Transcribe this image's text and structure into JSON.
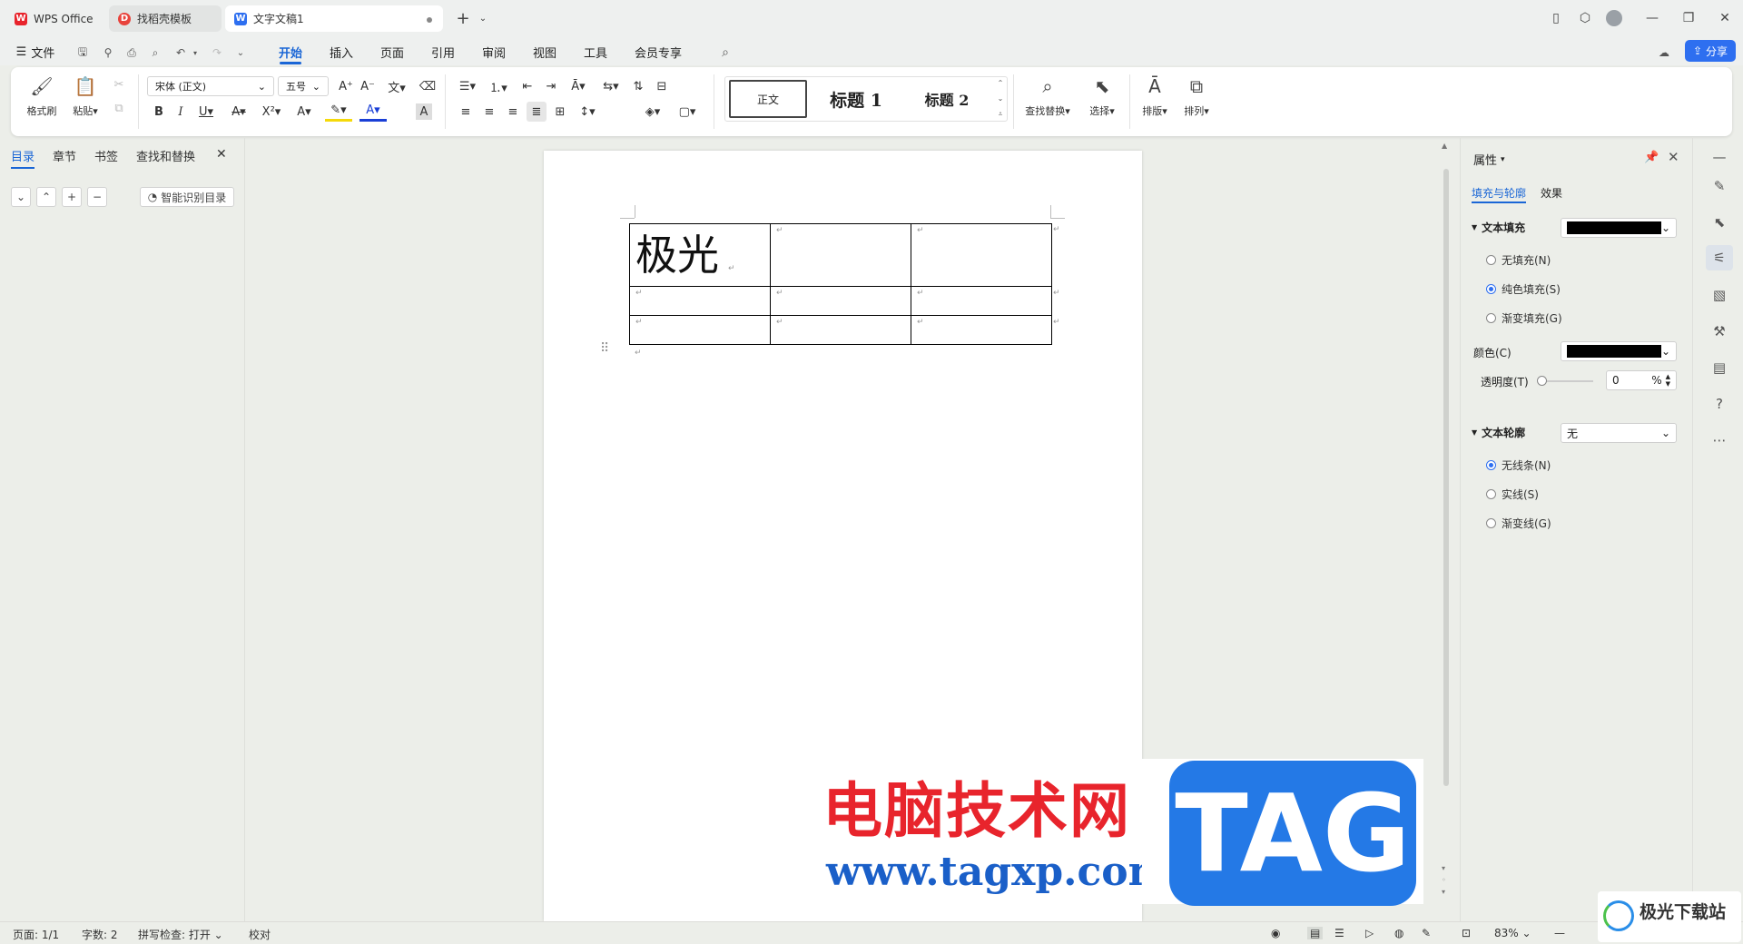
{
  "tabs": [
    {
      "label": "WPS Office",
      "icon": "wps-logo-icon"
    },
    {
      "label": "找稻壳模板",
      "icon": "docer-icon"
    },
    {
      "label": "文字文稿1",
      "icon": "writer-icon"
    }
  ],
  "menu": {
    "file": "文件",
    "items": [
      "开始",
      "插入",
      "页面",
      "引用",
      "审阅",
      "视图",
      "工具",
      "会员专享"
    ],
    "active": "开始",
    "share": "分享"
  },
  "ribbon": {
    "format_painter": "格式刷",
    "paste": "粘贴",
    "font_name": "宋体 (正文)",
    "font_size": "五号",
    "styles": [
      "正文",
      "标题 1",
      "标题 2"
    ],
    "find_replace": "查找替换",
    "select": "选择",
    "layout": "排版",
    "arrange": "排列"
  },
  "left_panel": {
    "tabs": [
      "目录",
      "章节",
      "书签",
      "查找和替换"
    ],
    "smart_toc": "智能识别目录"
  },
  "document": {
    "cell_text": "极光"
  },
  "right_panel": {
    "title": "属性",
    "tabs": [
      "填充与轮廓",
      "效果"
    ],
    "text_fill": {
      "label": "文本填充",
      "options": [
        "无填充(N)",
        "纯色填充(S)",
        "渐变填充(G)"
      ],
      "selected": 1,
      "color_label": "颜色(C)",
      "transparency_label": "透明度(T)",
      "transparency_value": "0",
      "transparency_unit": "%",
      "fill_color": "#000000"
    },
    "text_outline": {
      "label": "文本轮廓",
      "value": "无",
      "options": [
        "无线条(N)",
        "实线(S)",
        "渐变线(G)"
      ],
      "selected": 0
    }
  },
  "status": {
    "page": "页面: 1/1",
    "words": "字数: 2",
    "spell": "拼写检查: 打开",
    "proof": "校对",
    "zoom": "83%"
  },
  "watermark": {
    "cn": "电脑技术网",
    "url": "www.tagxp.com",
    "tag": "TAG",
    "site": "极光下载站"
  },
  "colors": {
    "accent": "#1a66d6",
    "share": "#2e6ff0"
  }
}
